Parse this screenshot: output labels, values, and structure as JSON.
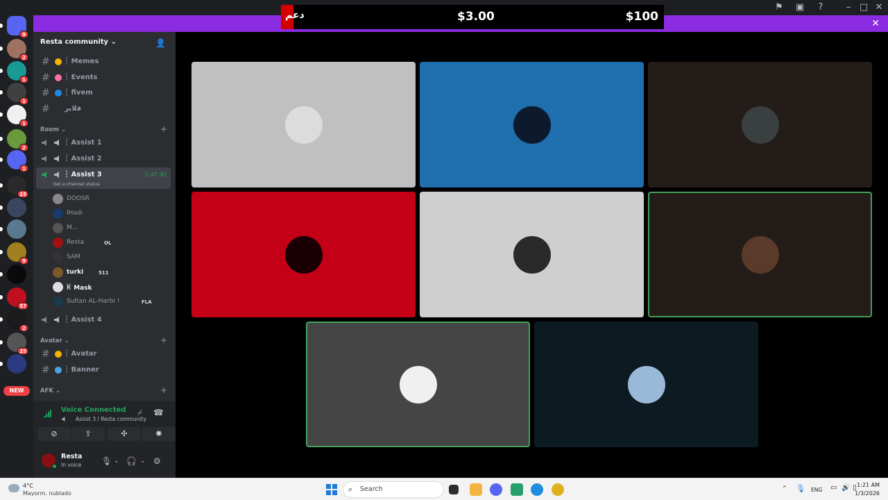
{
  "ticker": {
    "arabic": "دعم",
    "price_1": "$3.00",
    "price_2": "$100"
  },
  "server": {
    "name": "Resta community"
  },
  "servers": [
    {
      "badge": "9",
      "color": "#5865f2"
    },
    {
      "badge": "2",
      "color": "#a07060"
    },
    {
      "badge": "1",
      "color": "#1a9a94"
    },
    {
      "badge": "1",
      "color": "#404040"
    },
    {
      "badge": "1",
      "color": "#f0f0f0"
    },
    {
      "badge": "2",
      "color": "#6a9a3a"
    },
    {
      "badge": "1",
      "color": "#5865f2"
    },
    {
      "badge": "25",
      "color": "#2a2a2a"
    },
    {
      "badge": "",
      "color": "#3a4660"
    },
    {
      "badge": "",
      "color": "#5a7890"
    },
    {
      "badge": "9",
      "color": "#a08020"
    },
    {
      "badge": "",
      "color": "#0a0a0a"
    },
    {
      "badge": "57",
      "color": "#c01020"
    },
    {
      "badge": "2",
      "color": "#1a1a1a"
    },
    {
      "badge": "25",
      "color": "#555"
    },
    {
      "badge": "",
      "color": "#2b3a80"
    }
  ],
  "new_label": "NEW",
  "text_channels_top": [
    {
      "label": "┆ Memes",
      "emoji_color": "#f4b400"
    },
    {
      "label": "┆ Events",
      "emoji_color": "#ff6fa8"
    },
    {
      "label": "┆ fivem",
      "emoji_color": "#1e88e5"
    },
    {
      "label": "فلاير",
      "emoji_color": ""
    }
  ],
  "categories": {
    "room": "Room",
    "avatar": "Avatar",
    "afk": "AFK"
  },
  "voice_channels": [
    {
      "label": "┆ Assist 1"
    },
    {
      "label": "┆ Assist 2"
    },
    {
      "label": "┆ Assist 3",
      "timer": "1:47:01",
      "status": "Set a channel status"
    },
    {
      "label": "┆ Assist 4"
    }
  ],
  "voice_users": [
    {
      "name": "DOOSR",
      "tag": "",
      "color": "#888"
    },
    {
      "name": "lHadi",
      "tag": "",
      "color": "#1a3a6a"
    },
    {
      "name": "M...",
      "tag": "",
      "color": "#555"
    },
    {
      "name": "Resta",
      "tag": "OL",
      "color": "#a01010"
    },
    {
      "name": "SAM",
      "tag": "",
      "color": "#333"
    },
    {
      "name": "turki",
      "tag": "511",
      "color": "#7a5a2a",
      "bright": true
    },
    {
      "name": "ꀘ Mask",
      "tag": "",
      "color": "#ddd",
      "bright": true
    },
    {
      "name": "Sultan AL-Harbi !",
      "tag": "FLA",
      "color": "#1a3a4a"
    }
  ],
  "text_channels_avatar": [
    {
      "label": "┆ Avatar",
      "emoji_color": "#f4b400"
    },
    {
      "label": "┆ Banner",
      "emoji_color": "#4aa3df"
    }
  ],
  "voice_panel": {
    "title": "Voice Connected",
    "subtitle": "Assist 3 / Resta community"
  },
  "user": {
    "name": "Resta",
    "status": "In voice"
  },
  "tiles": [
    {
      "bg": "#c0c0c0",
      "avatar": "#dcdcdc",
      "speaking": false
    },
    {
      "bg": "#1f6ead",
      "avatar": "#0d1a2e",
      "speaking": false
    },
    {
      "bg": "#231c18",
      "avatar": "#3a3f40",
      "speaking": false
    },
    {
      "bg": "#c30016",
      "avatar": "#1a0004",
      "speaking": false
    },
    {
      "bg": "#cfcfcf",
      "avatar": "#2a2a2a",
      "speaking": false
    },
    {
      "bg": "#231c18",
      "avatar": "#5a3a28",
      "speaking": true
    },
    {
      "bg": "#454545",
      "avatar": "#f0f0f0",
      "speaking": true
    },
    {
      "bg": "#0c1a22",
      "avatar": "#9ab8d8",
      "speaking": false
    }
  ],
  "taskbar": {
    "weather_temp": "4°C",
    "weather_desc": "Mayorm. nublado",
    "search_placeholder": "Search",
    "lang": "ENG",
    "time": "1:21 AM",
    "date": "1/3/2026"
  }
}
